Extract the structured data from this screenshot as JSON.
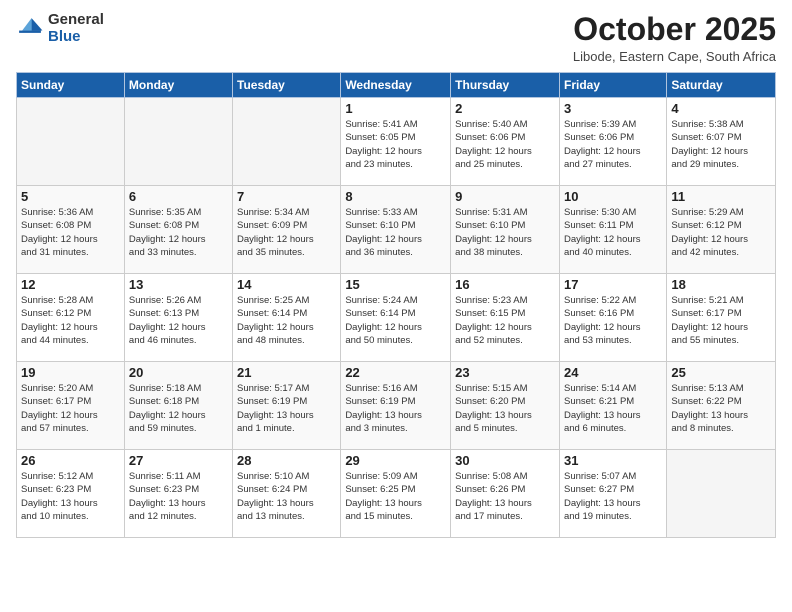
{
  "logo": {
    "general": "General",
    "blue": "Blue"
  },
  "title": "October 2025",
  "location": "Libode, Eastern Cape, South Africa",
  "weekdays": [
    "Sunday",
    "Monday",
    "Tuesday",
    "Wednesday",
    "Thursday",
    "Friday",
    "Saturday"
  ],
  "weeks": [
    [
      {
        "day": "",
        "info": ""
      },
      {
        "day": "",
        "info": ""
      },
      {
        "day": "",
        "info": ""
      },
      {
        "day": "1",
        "info": "Sunrise: 5:41 AM\nSunset: 6:05 PM\nDaylight: 12 hours\nand 23 minutes."
      },
      {
        "day": "2",
        "info": "Sunrise: 5:40 AM\nSunset: 6:06 PM\nDaylight: 12 hours\nand 25 minutes."
      },
      {
        "day": "3",
        "info": "Sunrise: 5:39 AM\nSunset: 6:06 PM\nDaylight: 12 hours\nand 27 minutes."
      },
      {
        "day": "4",
        "info": "Sunrise: 5:38 AM\nSunset: 6:07 PM\nDaylight: 12 hours\nand 29 minutes."
      }
    ],
    [
      {
        "day": "5",
        "info": "Sunrise: 5:36 AM\nSunset: 6:08 PM\nDaylight: 12 hours\nand 31 minutes."
      },
      {
        "day": "6",
        "info": "Sunrise: 5:35 AM\nSunset: 6:08 PM\nDaylight: 12 hours\nand 33 minutes."
      },
      {
        "day": "7",
        "info": "Sunrise: 5:34 AM\nSunset: 6:09 PM\nDaylight: 12 hours\nand 35 minutes."
      },
      {
        "day": "8",
        "info": "Sunrise: 5:33 AM\nSunset: 6:10 PM\nDaylight: 12 hours\nand 36 minutes."
      },
      {
        "day": "9",
        "info": "Sunrise: 5:31 AM\nSunset: 6:10 PM\nDaylight: 12 hours\nand 38 minutes."
      },
      {
        "day": "10",
        "info": "Sunrise: 5:30 AM\nSunset: 6:11 PM\nDaylight: 12 hours\nand 40 minutes."
      },
      {
        "day": "11",
        "info": "Sunrise: 5:29 AM\nSunset: 6:12 PM\nDaylight: 12 hours\nand 42 minutes."
      }
    ],
    [
      {
        "day": "12",
        "info": "Sunrise: 5:28 AM\nSunset: 6:12 PM\nDaylight: 12 hours\nand 44 minutes."
      },
      {
        "day": "13",
        "info": "Sunrise: 5:26 AM\nSunset: 6:13 PM\nDaylight: 12 hours\nand 46 minutes."
      },
      {
        "day": "14",
        "info": "Sunrise: 5:25 AM\nSunset: 6:14 PM\nDaylight: 12 hours\nand 48 minutes."
      },
      {
        "day": "15",
        "info": "Sunrise: 5:24 AM\nSunset: 6:14 PM\nDaylight: 12 hours\nand 50 minutes."
      },
      {
        "day": "16",
        "info": "Sunrise: 5:23 AM\nSunset: 6:15 PM\nDaylight: 12 hours\nand 52 minutes."
      },
      {
        "day": "17",
        "info": "Sunrise: 5:22 AM\nSunset: 6:16 PM\nDaylight: 12 hours\nand 53 minutes."
      },
      {
        "day": "18",
        "info": "Sunrise: 5:21 AM\nSunset: 6:17 PM\nDaylight: 12 hours\nand 55 minutes."
      }
    ],
    [
      {
        "day": "19",
        "info": "Sunrise: 5:20 AM\nSunset: 6:17 PM\nDaylight: 12 hours\nand 57 minutes."
      },
      {
        "day": "20",
        "info": "Sunrise: 5:18 AM\nSunset: 6:18 PM\nDaylight: 12 hours\nand 59 minutes."
      },
      {
        "day": "21",
        "info": "Sunrise: 5:17 AM\nSunset: 6:19 PM\nDaylight: 13 hours\nand 1 minute."
      },
      {
        "day": "22",
        "info": "Sunrise: 5:16 AM\nSunset: 6:19 PM\nDaylight: 13 hours\nand 3 minutes."
      },
      {
        "day": "23",
        "info": "Sunrise: 5:15 AM\nSunset: 6:20 PM\nDaylight: 13 hours\nand 5 minutes."
      },
      {
        "day": "24",
        "info": "Sunrise: 5:14 AM\nSunset: 6:21 PM\nDaylight: 13 hours\nand 6 minutes."
      },
      {
        "day": "25",
        "info": "Sunrise: 5:13 AM\nSunset: 6:22 PM\nDaylight: 13 hours\nand 8 minutes."
      }
    ],
    [
      {
        "day": "26",
        "info": "Sunrise: 5:12 AM\nSunset: 6:23 PM\nDaylight: 13 hours\nand 10 minutes."
      },
      {
        "day": "27",
        "info": "Sunrise: 5:11 AM\nSunset: 6:23 PM\nDaylight: 13 hours\nand 12 minutes."
      },
      {
        "day": "28",
        "info": "Sunrise: 5:10 AM\nSunset: 6:24 PM\nDaylight: 13 hours\nand 13 minutes."
      },
      {
        "day": "29",
        "info": "Sunrise: 5:09 AM\nSunset: 6:25 PM\nDaylight: 13 hours\nand 15 minutes."
      },
      {
        "day": "30",
        "info": "Sunrise: 5:08 AM\nSunset: 6:26 PM\nDaylight: 13 hours\nand 17 minutes."
      },
      {
        "day": "31",
        "info": "Sunrise: 5:07 AM\nSunset: 6:27 PM\nDaylight: 13 hours\nand 19 minutes."
      },
      {
        "day": "",
        "info": ""
      }
    ]
  ]
}
